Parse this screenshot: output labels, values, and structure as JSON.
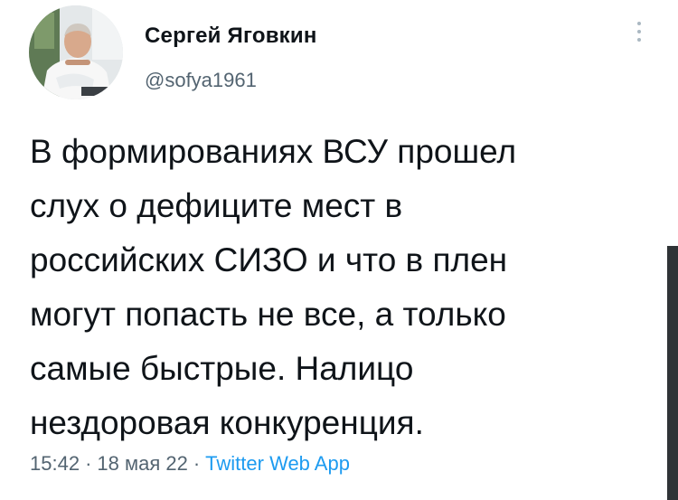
{
  "author": {
    "display_name": "Сергей Яговкин",
    "handle": "@sofya1961",
    "avatar_icon": "user-avatar-photo"
  },
  "tweet": {
    "lines": [
      "В формированиях ВСУ прошел",
      "слух о дефиците мест в",
      "российских СИЗО и что в плен",
      "могут попасть не все, а только",
      "самые быстрые. Налицо",
      "нездоровая конкуренция."
    ]
  },
  "meta": {
    "time": "15:42",
    "date": "18 мая 22",
    "separator": "·",
    "source": "Twitter Web App"
  },
  "icons": {
    "more": "more-vertical-icon"
  },
  "colors": {
    "text": "#0f1419",
    "secondary": "#536471",
    "link": "#1d9bf0",
    "background": "#ffffff"
  }
}
